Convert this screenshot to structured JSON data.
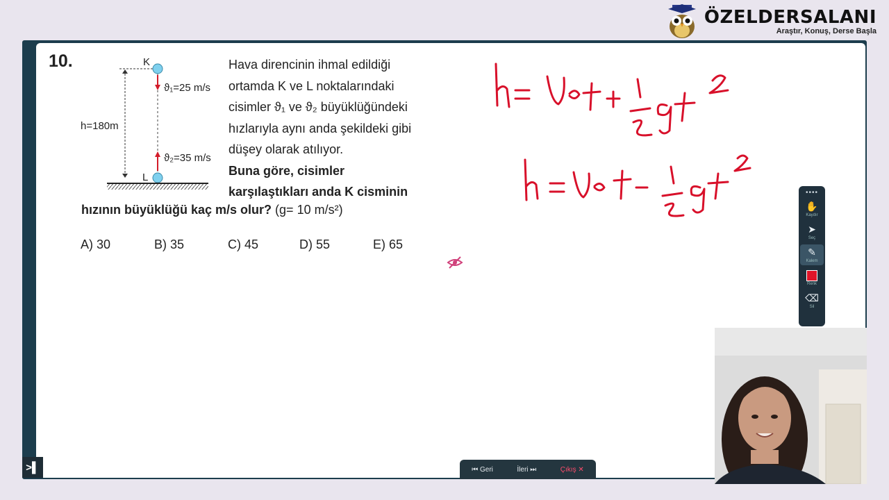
{
  "brand": {
    "name": "ÖZELDERSALANI",
    "slogan": "Araştır, Konuş, Derse Başla"
  },
  "question": {
    "number": "10.",
    "text_lines": [
      "Hava direncinin ihmal edildiği",
      "ortamda K ve L noktalarındaki",
      "cisimler ϑ₁ ve ϑ₂ büyüklüğündeki",
      "hızlarıyla aynı anda şekildeki gibi",
      "düşey olarak atılıyor."
    ],
    "bold_line1": "Buna göre, cisimler",
    "bold_line2": "karşılaştıkları anda K cisminin",
    "bold_line3": "hızının büyüklüğü kaç m/s olur?",
    "given": "(g= 10 m/s²)",
    "choices": [
      "A) 30",
      "B) 35",
      "C) 45",
      "D) 55",
      "E) 65"
    ]
  },
  "figure": {
    "label_k": "K",
    "label_l": "L",
    "v1": "ϑ₁=25 m/s",
    "v2": "ϑ₂=35 m/s",
    "height": "h=180m"
  },
  "toolbar": {
    "items": [
      {
        "icon": "hand-icon",
        "label": "Kaydır"
      },
      {
        "icon": "pointer-icon",
        "label": "Seç"
      },
      {
        "icon": "pen-icon",
        "label": "Kalem"
      },
      {
        "icon": "color-icon",
        "label": "Renk"
      },
      {
        "icon": "eraser-icon",
        "label": "Sil"
      }
    ]
  },
  "nav": {
    "back": "Geri",
    "next": "İleri",
    "exit": "Çıkış"
  },
  "colors": {
    "frame": "#1c3d4d",
    "ink": "#d8102a",
    "toolbar": "#20313d"
  }
}
